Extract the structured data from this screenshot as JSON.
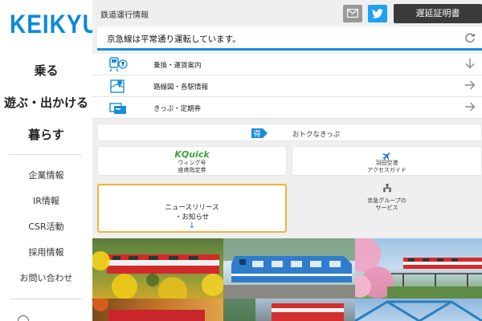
{
  "brand": {
    "logo_text": "KEIKYU",
    "color": "#0a8ad6"
  },
  "sidebar": {
    "main_nav": [
      {
        "label": "乗る"
      },
      {
        "label": "遊ぶ・出かける"
      },
      {
        "label": "暮らす"
      }
    ],
    "sub_nav": [
      {
        "label": "企業情報"
      },
      {
        "label": "IR情報"
      },
      {
        "label": "CSR活動"
      },
      {
        "label": "採用情報"
      },
      {
        "label": "お問い合わせ"
      }
    ]
  },
  "header": {
    "section_title": "鉄道運行情報",
    "mail_icon": "mail-icon",
    "twitter_icon": "twitter-icon",
    "certificate_button": "遅延証明書"
  },
  "status": {
    "message": "京急線は平常通り運転しています。",
    "accent": "#1a8cd8"
  },
  "quick_links": [
    {
      "label": "乗換・運賃案内",
      "icon": "train-yen-icon",
      "arrow": "arrow-down-icon"
    },
    {
      "label": "路線図・各駅情報",
      "icon": "route-map-icon",
      "arrow": "arrow-right-icon"
    },
    {
      "label": "きっぷ・定期券",
      "icon": "ticket-icon",
      "arrow": "arrow-right-icon"
    }
  ],
  "deals": {
    "label": "おトクなきっぷ",
    "badge": "得"
  },
  "kquick": {
    "brand": "KQuick",
    "line1": "ウィング号",
    "line2": "座席指定券"
  },
  "haneda": {
    "line1": "羽田空港",
    "line2": "アクセスガイド"
  },
  "news": {
    "line1": "ニュースリリース",
    "line2": "・お知らせ",
    "arrow": "↓",
    "border_color": "#f0b43a"
  },
  "group": {
    "line1": "京急グループの",
    "line2": "サービス"
  },
  "photos": [
    {
      "name": "photo-red-train-flowers"
    },
    {
      "name": "photo-blue-train"
    },
    {
      "name": "photo-red-train-cherry-blossoms"
    },
    {
      "name": "photo-red-train-autumn"
    },
    {
      "name": "photo-train-station"
    },
    {
      "name": "photo-train-bridge"
    }
  ]
}
